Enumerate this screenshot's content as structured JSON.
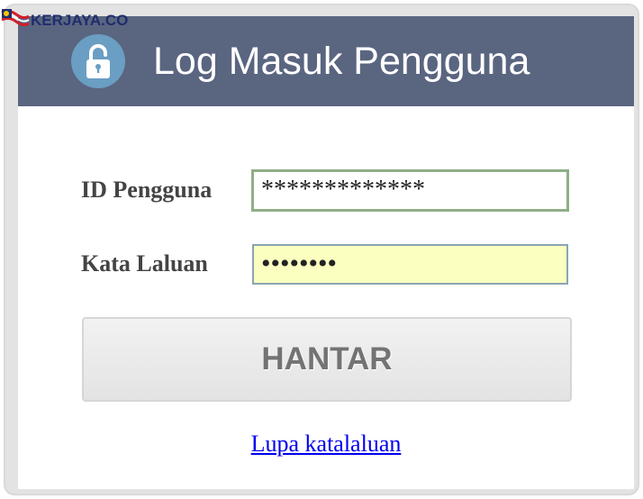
{
  "watermark": {
    "brand": "KERJAYA.CO"
  },
  "header": {
    "title": "Log Masuk Pengguna",
    "icon": "lock-icon",
    "background": "#5a6580"
  },
  "form": {
    "user_label": "ID Pengguna",
    "user_value": "*************",
    "password_label": "Kata Laluan",
    "password_value": "••••••••",
    "submit_label": "HANTAR",
    "forgot_link": "Lupa katalaluan"
  },
  "colors": {
    "password_field_bg": "#fbffc0",
    "user_field_border": "#8fae86",
    "link": "#0000ee"
  }
}
